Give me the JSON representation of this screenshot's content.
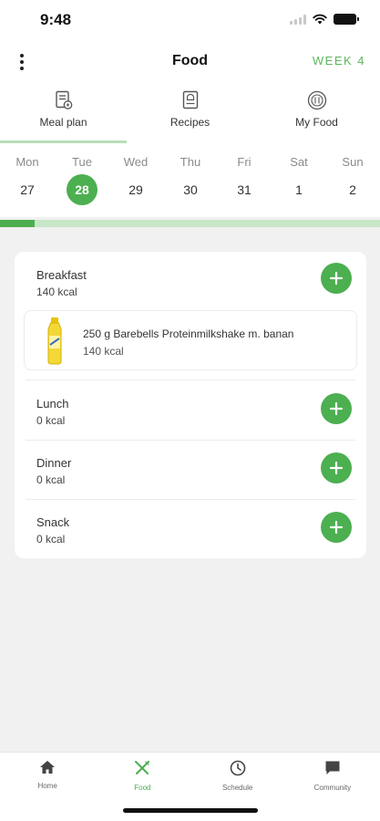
{
  "status_bar": {
    "time": "9:48"
  },
  "header": {
    "title": "Food",
    "week_label": "WEEK 4",
    "menu_icon": "more-vertical-icon"
  },
  "colors": {
    "accent": "#4caf50",
    "accent_light": "#c8e6c8",
    "background": "#f1f1f1"
  },
  "tabs": [
    {
      "label": "Meal plan",
      "icon": "meal-plan-icon",
      "active": true
    },
    {
      "label": "Recipes",
      "icon": "recipe-book-icon",
      "active": false
    },
    {
      "label": "My Food",
      "icon": "plate-icon",
      "active": false
    }
  ],
  "days": [
    {
      "name": "Mon",
      "number": "27"
    },
    {
      "name": "Tue",
      "number": "28",
      "selected": true
    },
    {
      "name": "Wed",
      "number": "29"
    },
    {
      "name": "Thu",
      "number": "30"
    },
    {
      "name": "Fri",
      "number": "31"
    },
    {
      "name": "Sat",
      "number": "1"
    },
    {
      "name": "Sun",
      "number": "2"
    }
  ],
  "week_progress": 0.09,
  "meals": {
    "breakfast": {
      "name": "Breakfast",
      "kcal": "140 kcal",
      "items": [
        {
          "name": "250 g Barebells Proteinmilkshake m. banan",
          "kcal": "140 kcal",
          "icon": "milkshake-bottle-icon"
        }
      ]
    },
    "lunch": {
      "name": "Lunch",
      "kcal": "0 kcal"
    },
    "dinner": {
      "name": "Dinner",
      "kcal": "0 kcal"
    },
    "snack": {
      "name": "Snack",
      "kcal": "0 kcal"
    }
  },
  "bottom_nav": [
    {
      "label": "Home",
      "icon": "home-icon",
      "active": false
    },
    {
      "label": "Food",
      "icon": "fork-knife-icon",
      "active": true
    },
    {
      "label": "Schedule",
      "icon": "clock-icon",
      "active": false
    },
    {
      "label": "Community",
      "icon": "chat-bubble-icon",
      "active": false
    }
  ]
}
